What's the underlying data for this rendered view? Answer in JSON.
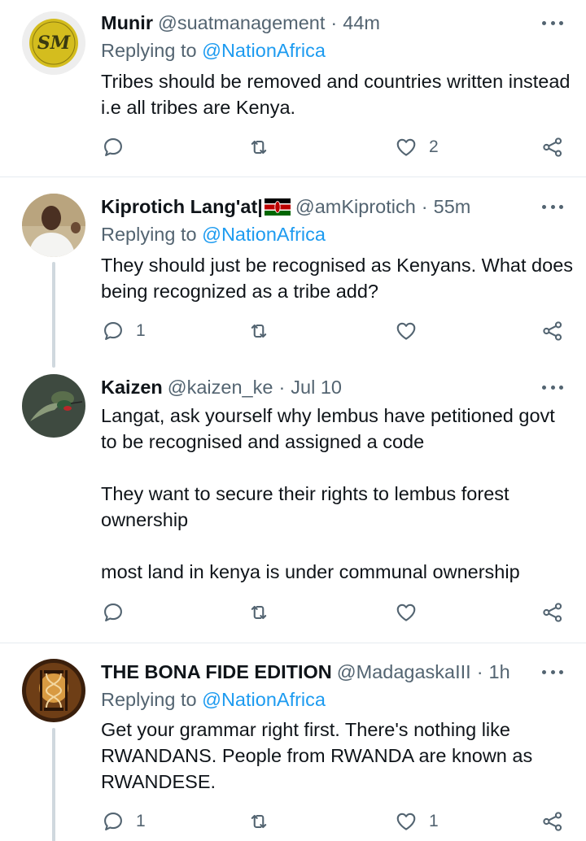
{
  "tweets": [
    {
      "name": "Munir",
      "handle": "@suatmanagement",
      "dot": "·",
      "time": "44m",
      "replying_prefix": "Replying to",
      "replying_to": "@NationAfrica",
      "text": "Tribes should be removed and countries written instead i.e all tribes are Kenya.",
      "replies": "",
      "retweets": "",
      "likes": "2",
      "avatar_monogram": "SM"
    },
    {
      "name": "Kiprotich Lang'at|",
      "handle": "@amKiprotich",
      "dot": "·",
      "time": "55m",
      "replying_prefix": "Replying to",
      "replying_to": "@NationAfrica",
      "text": "They should just be recognised as Kenyans. What does being recognized as a tribe add?",
      "replies": "1",
      "retweets": "",
      "likes": "",
      "name_icon": "kenya-flag-icon"
    },
    {
      "name": "Kaizen",
      "handle": "@kaizen_ke",
      "dot": "·",
      "time": "Jul 10",
      "text_lines": [
        "Langat, ask yourself why lembus have petitioned govt to be recognised and assigned a code",
        "They want to secure their rights to lembus forest ownership",
        "most land in kenya is under communal ownership"
      ],
      "replies": "",
      "retweets": "",
      "likes": ""
    },
    {
      "name": "THE BONA FIDE EDITION",
      "handle": "@MadagaskaIII",
      "dot": "·",
      "time": "1h",
      "replying_prefix": "Replying to",
      "replying_to": "@NationAfrica",
      "text": "Get your grammar right first. There's nothing like RWANDANS. People from RWANDA are known as RWANDESE.",
      "replies": "1",
      "retweets": "",
      "likes": "1"
    }
  ],
  "icons": {
    "reply": "reply-icon",
    "retweet": "retweet-icon",
    "like": "heart-icon",
    "share": "share-icon",
    "more": "more-options-icon"
  },
  "colors": {
    "text": "#0f1419",
    "secondary": "#536471",
    "mention": "#1d9bf0",
    "separator": "#e6ecf0"
  }
}
